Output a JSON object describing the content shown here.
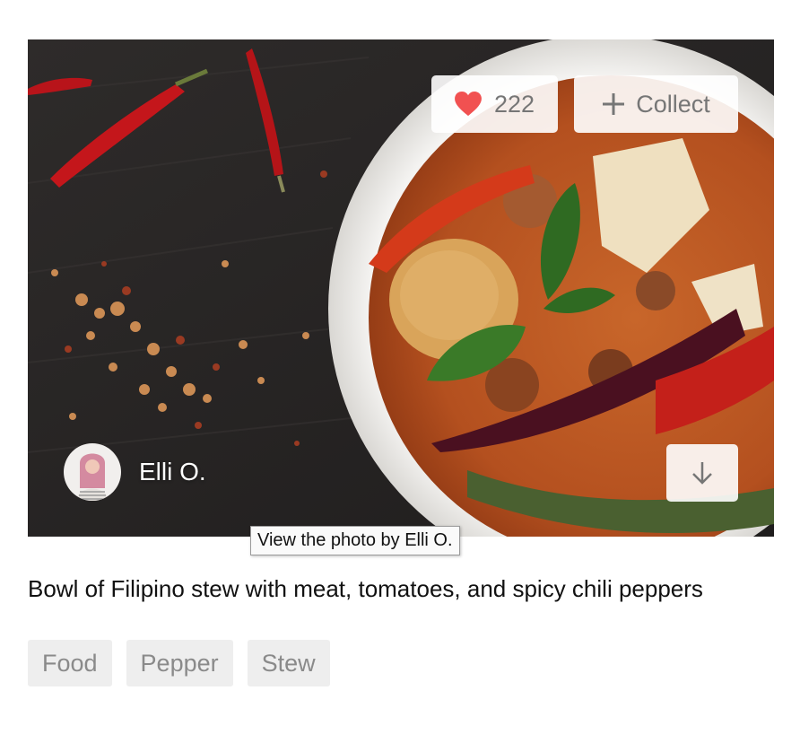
{
  "photo": {
    "alt": "Bowl of Filipino stew with meat, tomatoes, and spicy chili peppers"
  },
  "like": {
    "count": "222"
  },
  "collect": {
    "label": "Collect"
  },
  "author": {
    "name": "Elli O."
  },
  "tooltip": {
    "text": "View the photo by Elli O."
  },
  "caption": "Bowl of Filipino stew with meat, tomatoes, and spicy chili peppers",
  "tags": [
    {
      "label": "Food"
    },
    {
      "label": "Pepper"
    },
    {
      "label": "Stew"
    }
  ],
  "colors": {
    "heart": "#f15151",
    "button_text": "#767676",
    "tag_bg": "#eeeeee",
    "tag_text": "#8a8a8a"
  },
  "icons": {
    "like": "heart-icon",
    "collect": "plus-icon",
    "download": "arrow-down-icon"
  }
}
